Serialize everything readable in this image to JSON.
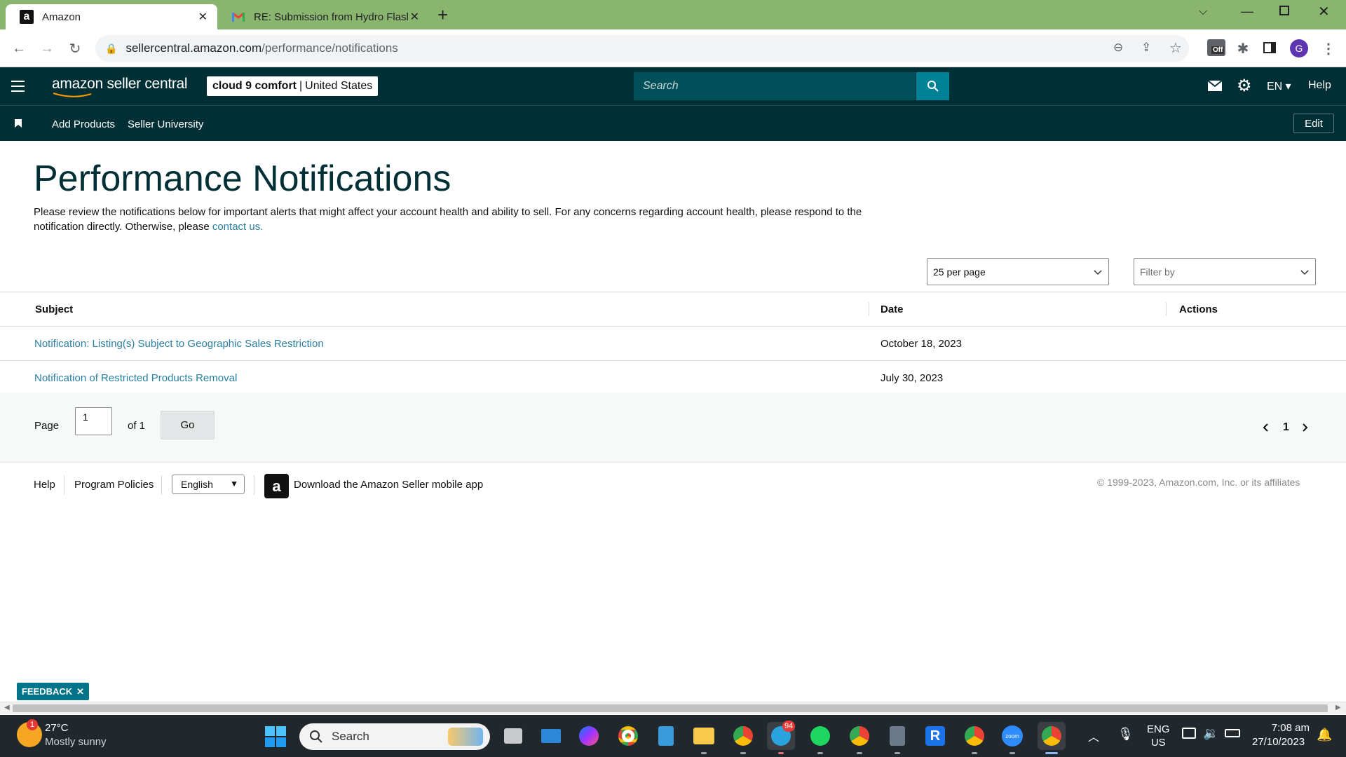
{
  "browser": {
    "tabs": [
      {
        "title": "Amazon",
        "favicon": "amazon-a-icon",
        "active": true
      },
      {
        "title": "RE: Submission from Hydro Flasl",
        "favicon": "gmail-icon",
        "active": false
      }
    ],
    "new_tab": "+",
    "url_domain": "sellercentral.amazon.com",
    "url_path": "/performance/notifications",
    "profile_initial": "G",
    "ext_badge": "Off"
  },
  "header": {
    "logo_text": "amazon seller central",
    "store_name": "cloud 9 comfort",
    "store_region": "United States",
    "search_placeholder": "Search",
    "language": "EN",
    "help": "Help"
  },
  "nav": {
    "items": [
      "Add Products",
      "Seller University"
    ],
    "edit": "Edit"
  },
  "page": {
    "title": "Performance Notifications",
    "description": "Please review the notifications below for important alerts that might affect your account health and ability to sell. For any concerns regarding account health, please respond to the notification directly. Otherwise, please ",
    "contact_link": "contact us."
  },
  "controls": {
    "per_page": "25 per page",
    "filter_placeholder": "Filter by"
  },
  "table": {
    "headers": [
      "Subject",
      "Date",
      "Actions"
    ],
    "rows": [
      {
        "subject": "Notification: Listing(s) Subject to Geographic Sales Restriction",
        "date": "October 18, 2023"
      },
      {
        "subject": "Notification of Restricted Products Removal",
        "date": "July 30, 2023"
      }
    ]
  },
  "pager": {
    "page_label": "Page",
    "page_value": "1",
    "of_label": "of 1",
    "go": "Go",
    "current": "1"
  },
  "footer": {
    "help": "Help",
    "policies": "Program Policies",
    "language": "English",
    "app_text": "Download the Amazon Seller mobile app",
    "copyright": "© 1999-2023, Amazon.com, Inc. or its affiliates"
  },
  "feedback": "FEEDBACK",
  "taskbar": {
    "weather_temp": "27°C",
    "weather_desc": "Mostly sunny",
    "weather_badge": "1",
    "search_placeholder": "Search",
    "telegram_badge": "94",
    "lang_top": "ENG",
    "lang_bottom": "US",
    "time": "7:08 am",
    "date": "27/10/2023"
  }
}
